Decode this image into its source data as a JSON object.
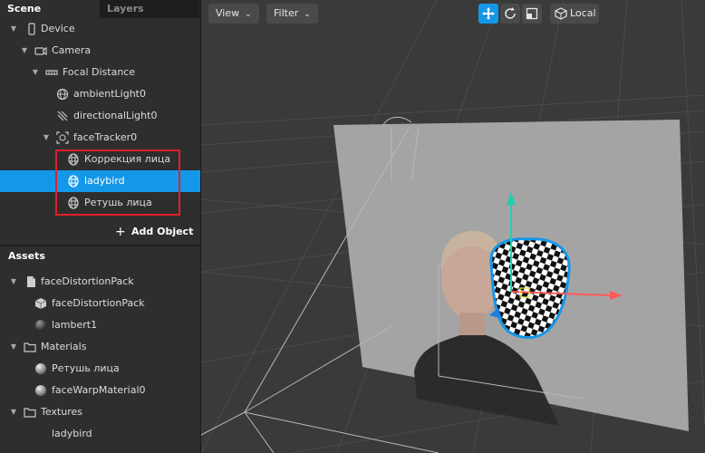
{
  "tabs": {
    "scene": "Scene",
    "layers": "Layers"
  },
  "scene_tree": [
    {
      "label": "Device",
      "icon": "device-icon"
    },
    {
      "label": "Camera",
      "icon": "camera-icon"
    },
    {
      "label": "Focal Distance",
      "icon": "focal-distance-icon"
    },
    {
      "label": "ambientLight0",
      "icon": "ambient-light-icon"
    },
    {
      "label": "directionalLight0",
      "icon": "directional-light-icon"
    },
    {
      "label": "faceTracker0",
      "icon": "face-tracker-icon"
    },
    {
      "label": "Коррекция лица",
      "icon": "face-mesh-icon"
    },
    {
      "label": "ladybird",
      "icon": "face-mesh-icon",
      "selected": true
    },
    {
      "label": "Ретушь лица",
      "icon": "face-mesh-icon"
    }
  ],
  "add_object": "Add Object",
  "assets_title": "Assets",
  "assets_tree": [
    {
      "label": "faceDistortionPack",
      "icon": "file-icon"
    },
    {
      "label": "faceDistortionPack",
      "icon": "cube-icon"
    },
    {
      "label": "lambert1",
      "icon": "material-sphere-icon"
    },
    {
      "label": "Materials",
      "icon": "folder-icon"
    },
    {
      "label": "Ретушь лица",
      "icon": "material-sphere-icon"
    },
    {
      "label": "faceWarpMaterial0",
      "icon": "material-sphere-icon"
    },
    {
      "label": "Textures",
      "icon": "folder-icon"
    },
    {
      "label": "ladybird",
      "icon": "texture-icon"
    }
  ],
  "viewport": {
    "view_label": "View",
    "filter_label": "Filter",
    "local_label": "Local",
    "tools": [
      "move-tool-icon",
      "rotate-tool-icon",
      "scale-tool-icon"
    ]
  },
  "colors": {
    "accent": "#1597e8",
    "highlight": "#e0202a",
    "x_axis": "#ff5a5a",
    "y_axis": "#20d0b0"
  }
}
